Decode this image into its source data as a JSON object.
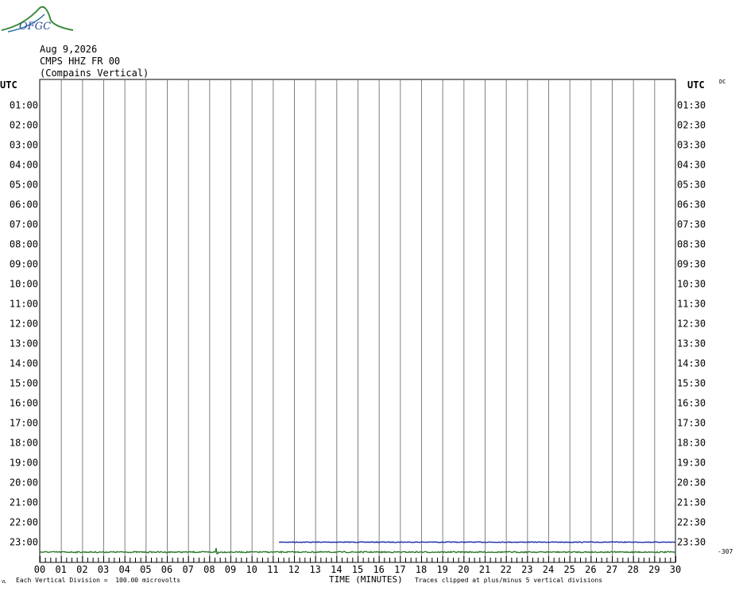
{
  "header": {
    "logo_text": "OFGC",
    "date": "Aug 9,2026",
    "station": "CMPS HHZ FR 00",
    "location": "(Compains Vertical)"
  },
  "axis": {
    "left_label": "UTC",
    "right_label": "UTC",
    "dc_label": "DC",
    "offset_label": "-307",
    "x_title": "TIME (MINUTES)"
  },
  "footer": {
    "scale_note": "Each Vertical Division =  100.00 microvolts",
    "clip_note": "Traces clipped at plus/minus 5 vertical divisions",
    "corner_mark": "VL"
  },
  "colors": {
    "trace_blue": "#1a2fa6",
    "trace_green": "#2f7a2f",
    "grid": "#808080"
  },
  "chart_data": {
    "type": "line",
    "title": "",
    "x_ticks": [
      "00",
      "01",
      "02",
      "03",
      "04",
      "05",
      "06",
      "07",
      "08",
      "09",
      "10",
      "11",
      "12",
      "13",
      "14",
      "15",
      "16",
      "17",
      "18",
      "19",
      "20",
      "21",
      "22",
      "23",
      "24",
      "25",
      "26",
      "27",
      "28",
      "29",
      "30"
    ],
    "xlim": [
      0,
      30
    ],
    "left_hour_labels": [
      "01:00",
      "02:00",
      "03:00",
      "04:00",
      "05:00",
      "06:00",
      "07:00",
      "08:00",
      "09:00",
      "10:00",
      "11:00",
      "12:00",
      "13:00",
      "14:00",
      "15:00",
      "16:00",
      "17:00",
      "18:00",
      "19:00",
      "20:00",
      "21:00",
      "22:00",
      "23:00"
    ],
    "right_hour_labels": [
      "01:30",
      "02:30",
      "03:30",
      "04:30",
      "05:30",
      "06:30",
      "07:30",
      "08:30",
      "09:30",
      "10:30",
      "11:30",
      "12:30",
      "13:30",
      "14:30",
      "15:30",
      "16:30",
      "17:30",
      "18:30",
      "19:30",
      "20:30",
      "21:30",
      "22:30",
      "23:30"
    ],
    "series": [
      {
        "row": "23:00",
        "start_min": 11.3,
        "end_min": 30,
        "color": "#1a2fa6",
        "amplitude": 0.15
      },
      {
        "row": "23:30",
        "start_min": 0,
        "end_min": 30,
        "color": "#2f7a2f",
        "amplitude": 0.25,
        "spike_min": 8.35,
        "spike_amp": 0.5
      }
    ]
  }
}
